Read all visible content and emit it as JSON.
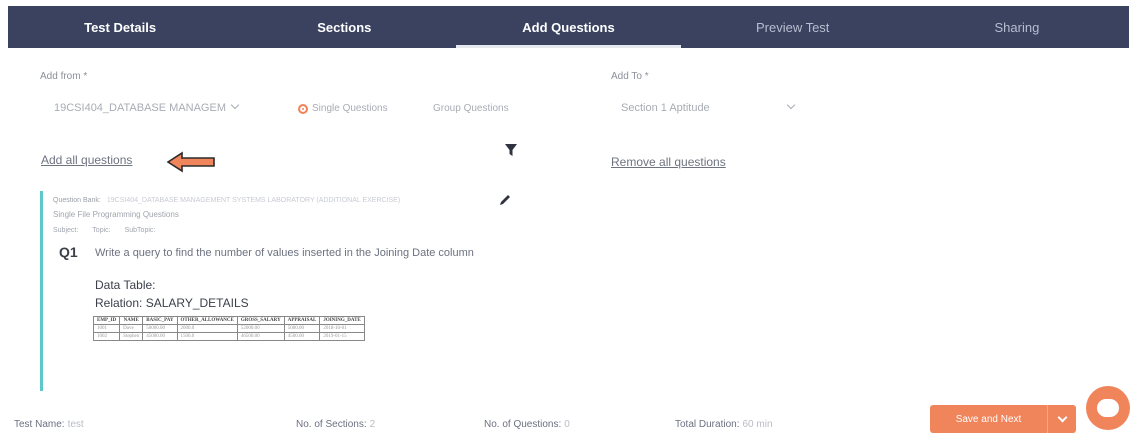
{
  "tabs": [
    {
      "label": "Test Details"
    },
    {
      "label": "Sections"
    },
    {
      "label": "Add Questions"
    },
    {
      "label": "Preview Test"
    },
    {
      "label": "Sharing"
    }
  ],
  "add_from": {
    "label": "Add from *",
    "value": "19CSI404_DATABASE MANAGEM",
    "radio_single": "Single Questions",
    "radio_group": "Group Questions"
  },
  "add_to": {
    "label": "Add To *",
    "value": "Section 1 Aptitude"
  },
  "links": {
    "add_all": "Add all questions",
    "remove_all": "Remove all questions"
  },
  "question": {
    "bank_label": "Question Bank:",
    "bank_value": "19CSI404_DATABASE MANAGEMENT SYSTEMS LABORATORY (ADDITIONAL EXERCISE)",
    "type": "Single File Programming Questions",
    "meta": [
      "Subject:",
      "Topic:",
      "SubTopic:"
    ],
    "number": "Q1",
    "text": "Write a query to find the number of values inserted in the Joining Date column",
    "data_table_title": "Data Table:",
    "relation": "Relation: SALARY_DETAILS",
    "columns": [
      "EMP_ID",
      "NAME",
      "BASIC_PAY",
      "OTHER_ALLOWANCE",
      "GROSS_SALARY",
      "APPRAISAL",
      "JOINING_DATE"
    ],
    "rows": [
      [
        "1001",
        "Dave",
        "50000.00",
        "2000.0",
        "52000.00",
        "5000.00",
        "2018-10-01"
      ],
      [
        "1002",
        "Stephen",
        "45000.00",
        "1500.0",
        "46500.00",
        "4500.00",
        "2019-01-15"
      ]
    ]
  },
  "footer": {
    "test_name_label": "Test Name:",
    "test_name_value": "test",
    "sections_label": "No. of Sections:",
    "sections_value": "2",
    "questions_label": "No. of Questions:",
    "questions_value": "0",
    "duration_label": "Total Duration:",
    "duration_value": "60 min",
    "save_label": "Save and Next"
  }
}
